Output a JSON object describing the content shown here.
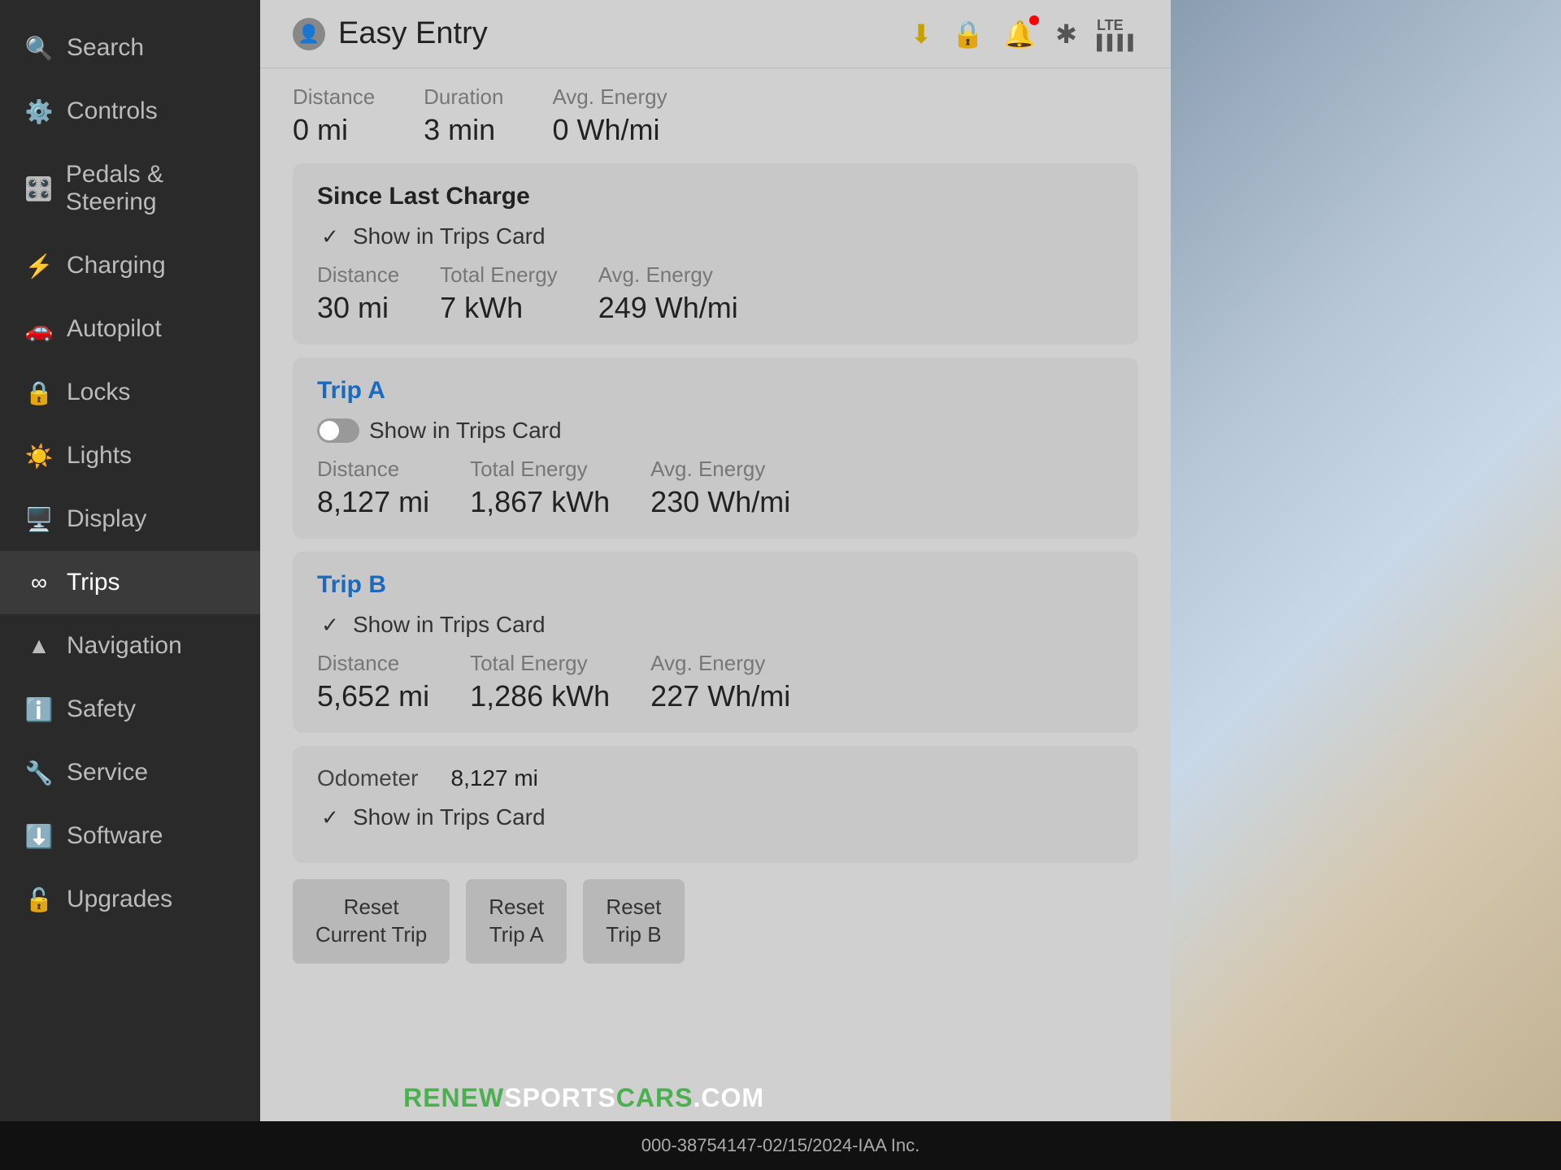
{
  "sidebar": {
    "items": [
      {
        "id": "search",
        "label": "Search",
        "icon": "🔍",
        "active": false
      },
      {
        "id": "controls",
        "label": "Controls",
        "icon": "⚙️",
        "active": false
      },
      {
        "id": "pedals-steering",
        "label": "Pedals & Steering",
        "icon": "🎛️",
        "active": false
      },
      {
        "id": "charging",
        "label": "Charging",
        "icon": "⚡",
        "active": false
      },
      {
        "id": "autopilot",
        "label": "Autopilot",
        "icon": "🚗",
        "active": false
      },
      {
        "id": "locks",
        "label": "Locks",
        "icon": "🔒",
        "active": false
      },
      {
        "id": "lights",
        "label": "Lights",
        "icon": "☀️",
        "active": false
      },
      {
        "id": "display",
        "label": "Display",
        "icon": "🖥️",
        "active": false
      },
      {
        "id": "trips",
        "label": "Trips",
        "icon": "∞",
        "active": true
      },
      {
        "id": "navigation",
        "label": "Navigation",
        "icon": "▲",
        "active": false
      },
      {
        "id": "safety",
        "label": "Safety",
        "icon": "ℹ️",
        "active": false
      },
      {
        "id": "service",
        "label": "Service",
        "icon": "🔧",
        "active": false
      },
      {
        "id": "software",
        "label": "Software",
        "icon": "⬇️",
        "active": false
      },
      {
        "id": "upgrades",
        "label": "Upgrades",
        "icon": "🔓",
        "active": false
      }
    ]
  },
  "header": {
    "title": "Easy Entry",
    "profile_icon": "👤"
  },
  "top_icons": {
    "download": "⬇",
    "lock": "🔒",
    "bell": "🔔",
    "bluetooth": "🔵",
    "lte": "LTE"
  },
  "current_trip": {
    "distance_label": "Distance",
    "distance_value": "0 mi",
    "duration_label": "Duration",
    "duration_value": "3 min",
    "avg_energy_label": "Avg. Energy",
    "avg_energy_value": "0 Wh/mi"
  },
  "since_last_charge": {
    "title": "Since Last Charge",
    "show_in_trips_label": "Show in Trips Card",
    "show_checked": true,
    "distance_label": "Distance",
    "distance_value": "30 mi",
    "total_energy_label": "Total Energy",
    "total_energy_value": "7 kWh",
    "avg_energy_label": "Avg. Energy",
    "avg_energy_value": "249 Wh/mi"
  },
  "trip_a": {
    "title": "Trip A",
    "show_in_trips_label": "Show in Trips Card",
    "show_checked": false,
    "distance_label": "Distance",
    "distance_value": "8,127 mi",
    "total_energy_label": "Total Energy",
    "total_energy_value": "1,867 kWh",
    "avg_energy_label": "Avg. Energy",
    "avg_energy_value": "230 Wh/mi"
  },
  "trip_b": {
    "title": "Trip B",
    "show_in_trips_label": "Show in Trips Card",
    "show_checked": true,
    "distance_label": "Distance",
    "distance_value": "5,652 mi",
    "total_energy_label": "Total Energy",
    "total_energy_value": "1,286 kWh",
    "avg_energy_label": "Avg. Energy",
    "avg_energy_value": "227 Wh/mi"
  },
  "odometer": {
    "label": "Odometer",
    "value": "8,127 mi",
    "show_in_trips_label": "Show in Trips Card",
    "show_checked": true
  },
  "buttons": {
    "reset_current_trip": "Reset\nCurrent Trip",
    "reset_trip_a": "Reset\nTrip A",
    "reset_trip_b": "Reset\nTrip B"
  },
  "bottom_bar": {
    "phone": "000-38754147",
    "date": "02/15/2024",
    "company": "IAA Inc."
  },
  "watermark": {
    "renew": "RENEW",
    "sports": "SPORTS",
    "cars": "CARS",
    "com": ".COM"
  }
}
